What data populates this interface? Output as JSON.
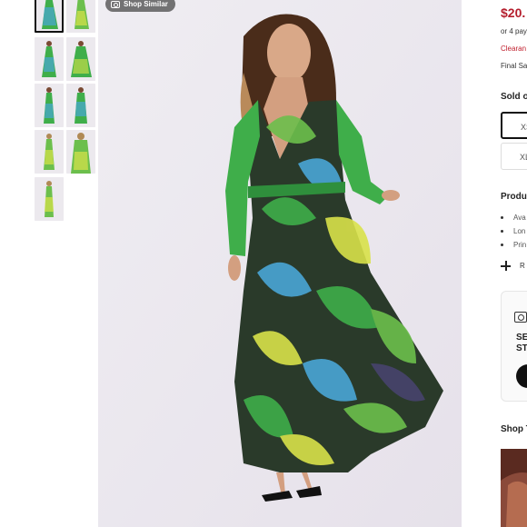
{
  "overlay": {
    "shop_similar": "Shop Similar"
  },
  "product": {
    "price": "$20.",
    "pay_text": "or 4 pay",
    "clearance": "Clearan",
    "final_sale": "Final Sa"
  },
  "sizes": {
    "heading": "Sold o",
    "options": [
      {
        "label": "XS",
        "selected": true
      },
      {
        "label": "XL",
        "selected": false
      }
    ]
  },
  "details": {
    "heading": "Produ",
    "bullets": [
      "Ava",
      "Lon",
      "Prin"
    ],
    "expand_label": "R"
  },
  "see_card": {
    "line1": "SE",
    "line2": "ST"
  },
  "shop_look": {
    "heading": "Shop T"
  },
  "colors": {
    "price": "#b51e2d",
    "clearance": "#c0202e",
    "dress_green": "#3fae4a",
    "dress_blue": "#4aa6d6",
    "dress_yellow": "#d9e24a"
  }
}
